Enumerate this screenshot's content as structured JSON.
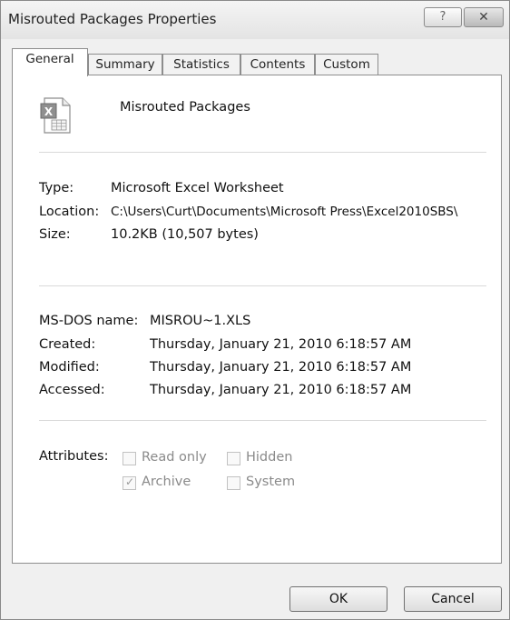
{
  "window": {
    "title": "Misrouted Packages Properties",
    "help_label": "?",
    "close_label": "✕"
  },
  "tabs": [
    {
      "label": "General"
    },
    {
      "label": "Summary"
    },
    {
      "label": "Statistics"
    },
    {
      "label": "Contents"
    },
    {
      "label": "Custom"
    }
  ],
  "active_tab": "General",
  "file": {
    "name": "Misrouted Packages",
    "icon": "excel-worksheet-icon"
  },
  "info": {
    "type_label": "Type:",
    "type_value": "Microsoft Excel Worksheet",
    "location_label": "Location:",
    "location_value": "C:\\Users\\Curt\\Documents\\Microsoft Press\\Excel2010SBS\\",
    "size_label": "Size:",
    "size_value": "10.2KB (10,507 bytes)"
  },
  "dates": {
    "msdos_label": "MS-DOS name:",
    "msdos_value": "MISROU~1.XLS",
    "created_label": "Created:",
    "created_value": "Thursday, January 21, 2010 6:18:57 AM",
    "modified_label": "Modified:",
    "modified_value": "Thursday, January 21, 2010 6:18:57 AM",
    "accessed_label": "Accessed:",
    "accessed_value": "Thursday, January 21, 2010 6:18:57 AM"
  },
  "attributes": {
    "label": "Attributes:",
    "read_only": {
      "label": "Read only",
      "checked": false
    },
    "hidden": {
      "label": "Hidden",
      "checked": false
    },
    "archive": {
      "label": "Archive",
      "checked": true
    },
    "system": {
      "label": "System",
      "checked": false
    }
  },
  "buttons": {
    "ok_label": "OK",
    "cancel_label": "Cancel"
  }
}
